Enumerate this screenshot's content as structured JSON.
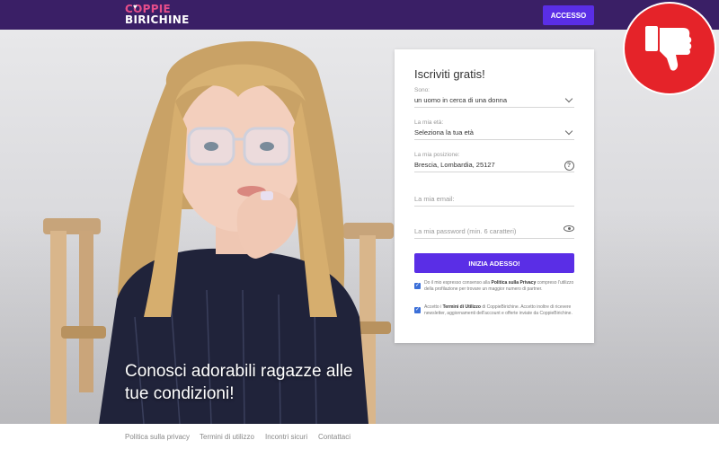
{
  "header": {
    "logo_line1": "COPPIE",
    "logo_line2": "BIRICHINE",
    "login_button": "ACCESSO"
  },
  "hero": {
    "headline_line1": "Conosci adorabili ragazze alle",
    "headline_line2": "tue condizioni!"
  },
  "form": {
    "title": "Iscriviti gratis!",
    "fields": {
      "sono": {
        "label": "Sono:",
        "value": "un uomo in cerca di una donna"
      },
      "eta": {
        "label": "La mia età:",
        "value": "Seleziona la tua età"
      },
      "posizione": {
        "label": "La mia posizione:",
        "value": "Brescia, Lombardia, 25127"
      },
      "email": {
        "placeholder": "La mia email:"
      },
      "password": {
        "placeholder": "La mia password (min. 6 caratteri)"
      }
    },
    "submit_label": "INIZIA ADESSO!",
    "consent1": {
      "prefix": "Do il mio espresso consenso alla ",
      "link": "Politica sulla Privacy",
      "suffix": " compreso l'utilizzo della profilazione per trovare un maggior numero di partner."
    },
    "consent2": {
      "prefix": "Accetto i ",
      "link": "Termini di Utilizzo",
      "suffix": " di CoppieBirichine. Accetto inoltre di ricevere newsletter, aggiornamenti dell'account e offerte inviate da CoppieBirichine."
    }
  },
  "footer": {
    "links": [
      "Politica sulla privacy",
      "Termini di utilizzo",
      "Incontri sicuri",
      "Contattaci"
    ]
  },
  "colors": {
    "header_bg": "#3a1f66",
    "accent": "#5a2ee6",
    "logo_pink": "#e64d8a",
    "badge_red": "#e52329",
    "checkbox_blue": "#3b6fd8"
  },
  "icons": {
    "badge": "thumbs-down-icon",
    "logo": "heart-icon",
    "select": "chevron-down-icon",
    "location": "question-icon",
    "password": "eye-icon",
    "consent": "checkbox-checked-icon"
  }
}
